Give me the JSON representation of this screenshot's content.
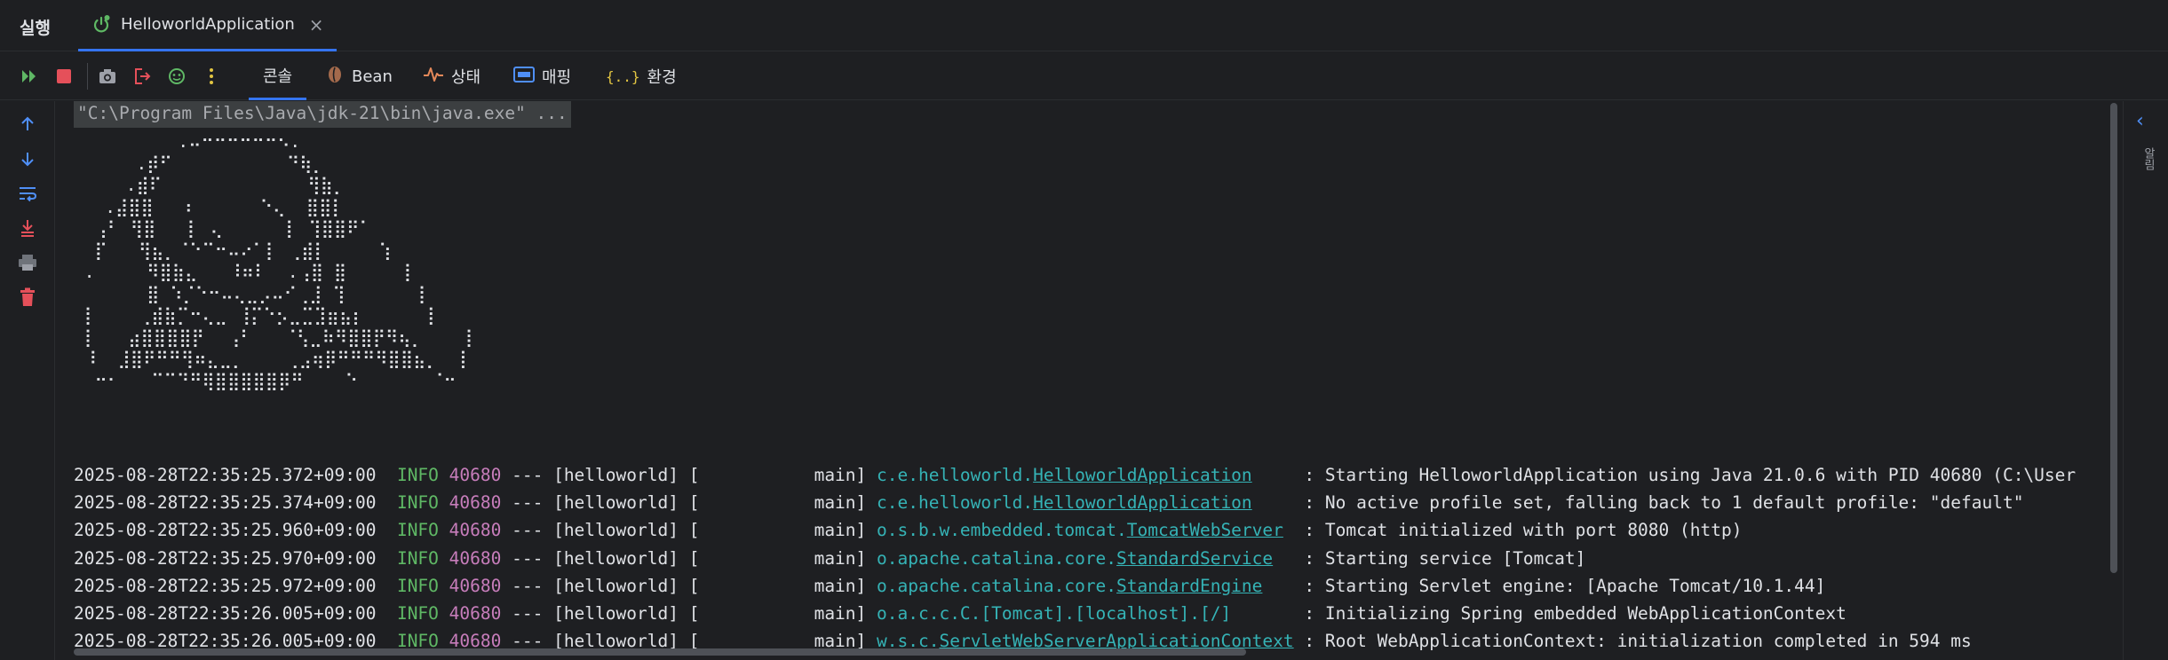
{
  "titlebar": {
    "title": "실행",
    "tab_label": "HelloworldApplication",
    "tab_close": "×"
  },
  "toolbar": {
    "buttons": [
      "rerun-icon",
      "stop-icon",
      "screenshot-icon",
      "exit-icon",
      "debug-icon",
      "more-icon"
    ],
    "tabs": [
      {
        "label": "콘솔",
        "active": true
      },
      {
        "label": "Bean",
        "active": false
      },
      {
        "label": "상태",
        "active": false
      },
      {
        "label": "매핑",
        "active": false
      },
      {
        "label": "환경",
        "active": false
      }
    ],
    "env_icon_text": "{..}"
  },
  "gutter": {
    "buttons": [
      "scroll-up-icon",
      "scroll-down-icon",
      "soft-wrap-icon",
      "scroll-to-end-icon",
      "print-icon",
      "clear-icon"
    ]
  },
  "console": {
    "command": "\"C:\\Program Files\\Java\\jdk-21\\bin\\java.exe\" ...",
    "banner": "          .⠤⠒⠒⠒⠒⠒⠒⠢.\n      .⡾⠋           ⠙⢷⡀\n     .⣾⠏              ⢻⣷⡀\n   .⣼⣿⣿   ⠆      ⠑⢄  ⣿⣿⡇\n  ⢠⠃ ⢻⣿   ⡇ ⢄      ⡇ ⢹⣿⣿⠟⠁\n  ⡏   ⢻⣦⡀⠈⠑⠉⠒⠤⠔⠁⡇ ⢀⣾⡇     ⢱\n .     ⠻⣿⣷⣄   ⠸⠶⠇  .⢠⣿ ⣿     ⢸\n       ⣿ ⠱⡈⠑⠒⠤⢄⣀⡠⠤⠊⢀⣸ ⢹       ⡇\n ⡇    ⢀⣾⣷⡉⠒⢄⣀ ⢸⡍⠑⡢⣀⣉⣹⣶⣦⡆      ⡇\n ⡇   ⣴⣿⣿⣿⣿⡟⠀ ⢠⠃   ⠈⢣⣀⠷⠻⣿⣿⡟⠻⢦⡀    ⡇\n ⠸  ⣸⣿⠟⠛⠛⢻⠶⣄⣀⡀    ⢀⣠⢶⡿⠛⠛⠛⠻⣿⣿⣦⡀  ⡇\n  ⠒⠂   ⠉⠉⠙⠛⢿⣿⣿⣿⣿⣿⡿⠛    ⠑       ⠈⠒",
    "lines": [
      {
        "ts": "2025-08-28T22:35:25.372+09:00",
        "level": "INFO",
        "pid": "40680",
        "mid": " --- [helloworld] [           main] ",
        "logger_prefix": "c.e.helloworld.",
        "logger_link": "HelloworldApplication",
        "pad": "     ",
        "msg": ": Starting HelloworldApplication using Java 21.0.6 with PID 40680 (C:\\User"
      },
      {
        "ts": "2025-08-28T22:35:25.374+09:00",
        "level": "INFO",
        "pid": "40680",
        "mid": " --- [helloworld] [           main] ",
        "logger_prefix": "c.e.helloworld.",
        "logger_link": "HelloworldApplication",
        "pad": "     ",
        "msg": ": No active profile set, falling back to 1 default profile: \"default\""
      },
      {
        "ts": "2025-08-28T22:35:25.960+09:00",
        "level": "INFO",
        "pid": "40680",
        "mid": " --- [helloworld] [           main] ",
        "logger_prefix": "o.s.b.w.embedded.tomcat.",
        "logger_link": "TomcatWebServer",
        "pad": "  ",
        "msg": ": Tomcat initialized with port 8080 (http)"
      },
      {
        "ts": "2025-08-28T22:35:25.970+09:00",
        "level": "INFO",
        "pid": "40680",
        "mid": " --- [helloworld] [           main] ",
        "logger_prefix": "o.apache.catalina.core.",
        "logger_link": "StandardService",
        "pad": "   ",
        "msg": ": Starting service [Tomcat]"
      },
      {
        "ts": "2025-08-28T22:35:25.972+09:00",
        "level": "INFO",
        "pid": "40680",
        "mid": " --- [helloworld] [           main] ",
        "logger_prefix": "o.apache.catalina.core.",
        "logger_link": "StandardEngine",
        "pad": "    ",
        "msg": ": Starting Servlet engine: [Apache Tomcat/10.1.44]"
      },
      {
        "ts": "2025-08-28T22:35:26.005+09:00",
        "level": "INFO",
        "pid": "40680",
        "mid": " --- [helloworld] [           main] ",
        "logger_prefix": "o.a.c.c.C.[Tomcat].[localhost].[/]",
        "logger_link": "",
        "pad": "       ",
        "msg": ": Initializing Spring embedded WebApplicationContext"
      },
      {
        "ts": "2025-08-28T22:35:26.005+09:00",
        "level": "INFO",
        "pid": "40680",
        "mid": " --- [helloworld] [           main] ",
        "logger_prefix": "w.s.c.",
        "logger_link": "ServletWebServerApplicationContext",
        "pad": " ",
        "msg": ": Root WebApplicationContext: initialization completed in 594 ms"
      }
    ]
  },
  "rightbar": {
    "label": "알림"
  },
  "colors": {
    "info": "#5fb865",
    "pid": "#c77dbb",
    "logger": "#35b3b6",
    "stop": "#e5505a",
    "rerun": "#5fb865",
    "accent": "#3574f0"
  }
}
